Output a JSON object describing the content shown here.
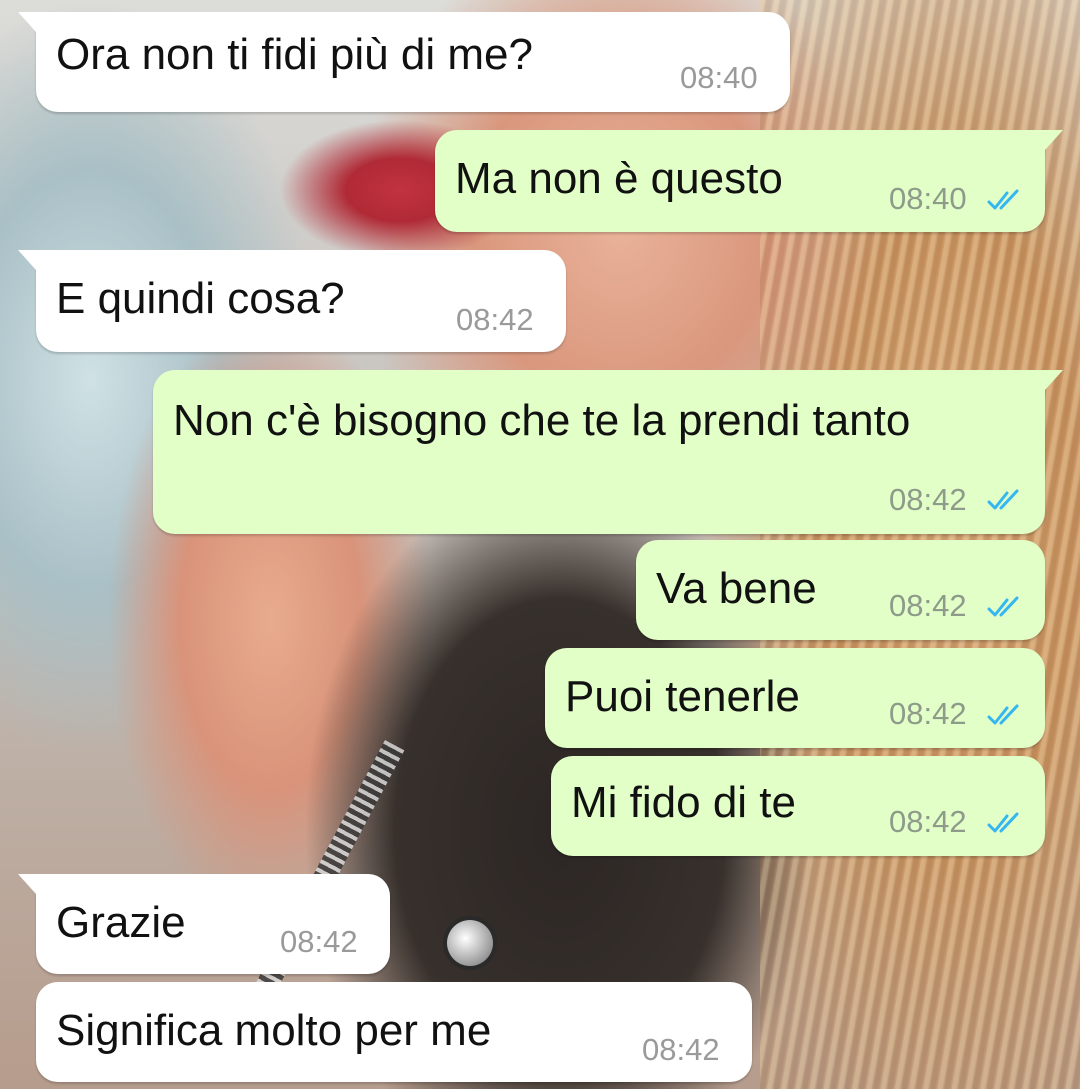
{
  "conversation": {
    "messages": [
      {
        "direction": "incoming",
        "text": "Ora non ti fidi più di me?",
        "time": "08:40"
      },
      {
        "direction": "outgoing",
        "text": "Ma non è questo",
        "time": "08:40",
        "status": "read"
      },
      {
        "direction": "incoming",
        "text": "E quindi cosa?",
        "time": "08:42"
      },
      {
        "direction": "outgoing",
        "text": "Non c'è bisogno che te la prendi tanto",
        "time": "08:42",
        "status": "read"
      },
      {
        "direction": "outgoing",
        "text": "Va bene",
        "time": "08:42",
        "status": "read"
      },
      {
        "direction": "outgoing",
        "text": "Puoi tenerle",
        "time": "08:42",
        "status": "read"
      },
      {
        "direction": "outgoing",
        "text": "Mi fido di te",
        "time": "08:42",
        "status": "read"
      },
      {
        "direction": "incoming",
        "text": "Grazie",
        "time": "08:42"
      },
      {
        "direction": "incoming",
        "text": "Significa molto per me",
        "time": "08:42"
      }
    ]
  },
  "colors": {
    "incoming_bubble": "#ffffff",
    "outgoing_bubble": "#e2ffc7",
    "read_ticks": "#34b7f1",
    "timestamp": "#9a9a9a"
  },
  "icons": {
    "read_receipt": "double-check-icon"
  }
}
